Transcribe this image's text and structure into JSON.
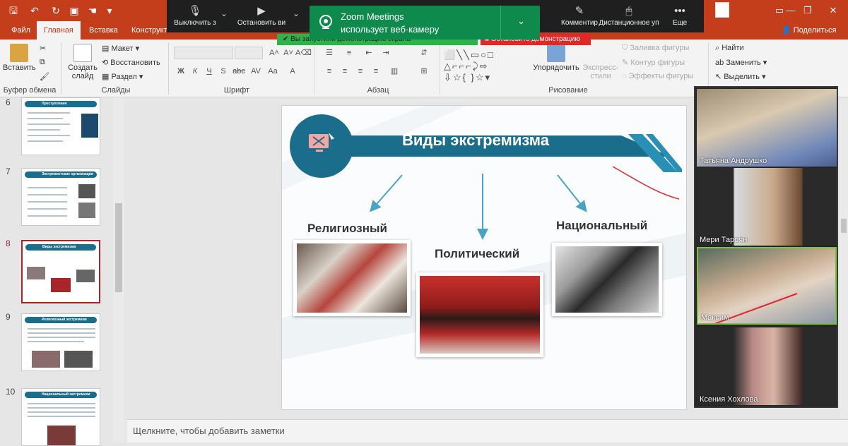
{
  "qat": {
    "icons": [
      "save-icon",
      "undo-icon",
      "redo-icon",
      "start-slideshow-icon",
      "touch-mode-icon",
      "customize-icon"
    ]
  },
  "tabs": [
    {
      "label": "Файл",
      "active": false
    },
    {
      "label": "Главная",
      "active": true
    },
    {
      "label": "Вставка",
      "active": false
    },
    {
      "label": "Конструкт",
      "active": false
    }
  ],
  "share_label": "Поделиться",
  "ribbon": {
    "clipboard": {
      "paste": "Вставить",
      "label": "Буфер обмена"
    },
    "slides": {
      "new_slide": "Создать слайд",
      "layout": "Макет",
      "reset": "Восстановить",
      "section": "Раздел",
      "label": "Слайды"
    },
    "font": {
      "label": "Шрифт",
      "buttons": [
        "Ж",
        "К",
        "Ч",
        "S",
        "abc",
        "AV",
        "Aa"
      ]
    },
    "paragraph": {
      "label": "Абзац"
    },
    "drawing": {
      "arrange": "Упорядочить",
      "quick_styles": "Экспресс-стили",
      "shape_fill": "Заливка фигуры",
      "shape_outline": "Контур фигуры",
      "shape_effects": "Эффекты фигуры",
      "label": "Рисование"
    },
    "editing": {
      "find": "Найти",
      "replace": "Заменить",
      "select": "Выделить"
    }
  },
  "zoom": {
    "toolbar": [
      {
        "label": "Выключить з",
        "icon": "microphone-icon"
      },
      {
        "label": "Остановить ви",
        "icon": "video-camera-icon"
      },
      {
        "label": "Комментир",
        "icon": "pen-icon"
      },
      {
        "label": "Дистанционное уп",
        "icon": "mouse-icon"
      },
      {
        "label": "Еще",
        "icon": "more-icon"
      }
    ],
    "toast": {
      "title": "Zoom Meetings",
      "message": "использует веб-камеру"
    },
    "share_status": "Вы запустили демонстрацию экрана",
    "stop_share": "Остановить демонстрацию"
  },
  "thumbnails": [
    {
      "number": "6",
      "title": "Преступления",
      "selected": false
    },
    {
      "number": "7",
      "title": "Экстремистские организации",
      "selected": false
    },
    {
      "number": "8",
      "title": "Виды экстремизма",
      "selected": true
    },
    {
      "number": "9",
      "title": "Религиозный экстремизм",
      "selected": false
    },
    {
      "number": "10",
      "title": "Национальный экстремизм",
      "selected": false
    }
  ],
  "slide": {
    "title": "Виды экстремизма",
    "categories": [
      "Религиозный",
      "Политический",
      "Национальный"
    ]
  },
  "notes_placeholder": "Щелкните, чтобы добавить заметки",
  "participants": [
    {
      "name": "Татьяна Андрушко"
    },
    {
      "name": "Мери Тароян"
    },
    {
      "name": "Максим"
    },
    {
      "name": "Ксения Хохлова"
    }
  ],
  "colors": {
    "accent": "#c43e1c",
    "slide_banner": "#1b6d8c",
    "arrow": "#4aa3c4",
    "zoom_green": "#0e8a4c",
    "stop_red": "#e02828"
  }
}
